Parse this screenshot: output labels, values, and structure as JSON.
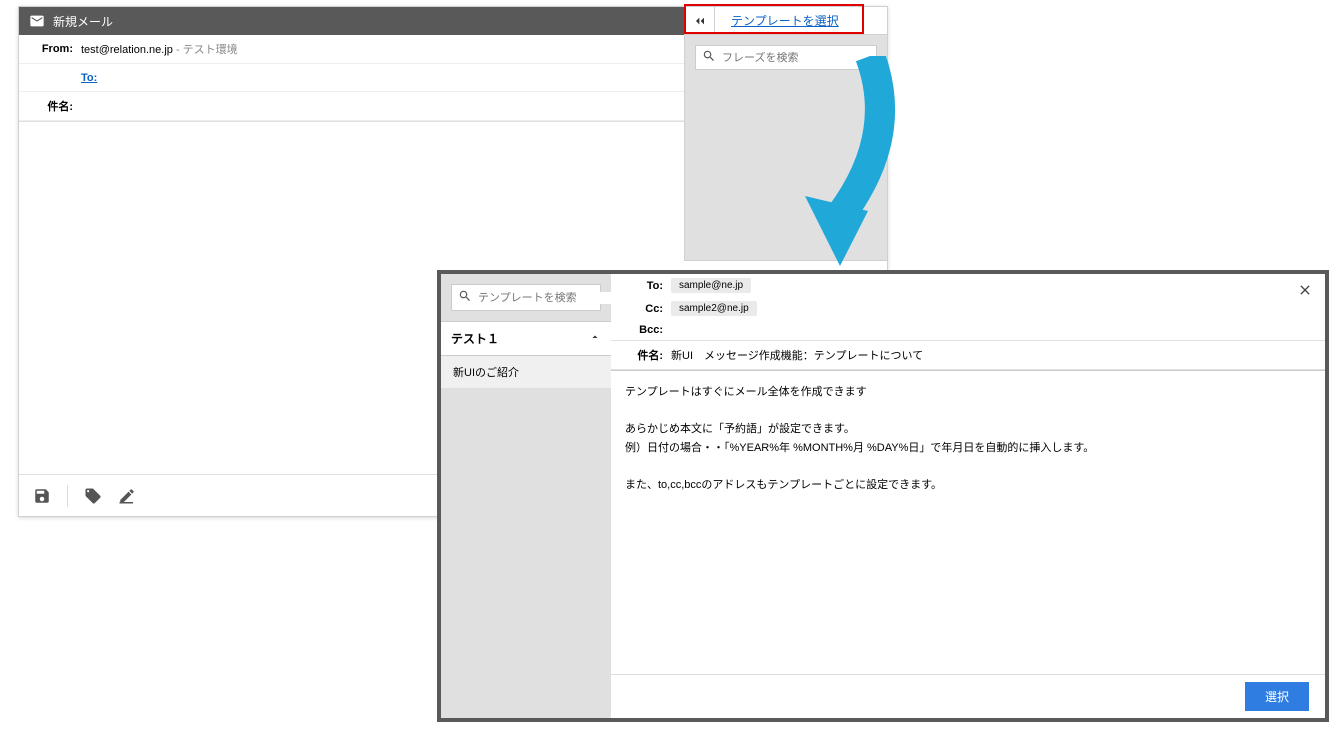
{
  "compose": {
    "title": "新規メール",
    "from_label": "From:",
    "from_value": "test@relation.ne.jp",
    "from_env": " - テスト環境",
    "to_label": "To:",
    "subject_label": "件名:"
  },
  "side_panel": {
    "template_link": "テンプレートを選択",
    "search_placeholder": "フレーズを検索"
  },
  "template_dialog": {
    "search_placeholder": "テンプレートを検索",
    "group_name": "テスト１",
    "group_item": "新UIのご紹介",
    "to_label": "To:",
    "to_chip": "sample@ne.jp",
    "cc_label": "Cc:",
    "cc_chip": "sample2@ne.jp",
    "bcc_label": "Bcc:",
    "subject_label": "件名:",
    "subject_value": "新UI　メッセージ作成機能：テンプレートについて",
    "body_line1": "テンプレートはすぐにメール全体を作成できます",
    "body_line2": "あらかじめ本文に「予約語」が設定できます。",
    "body_line3": "例）日付の場合・・「%YEAR%年 %MONTH%月 %DAY%日」で年月日を自動的に挿入します。",
    "body_line4": "また、to,cc,bccのアドレスもテンプレートごとに設定できます。",
    "select_button": "選択"
  }
}
